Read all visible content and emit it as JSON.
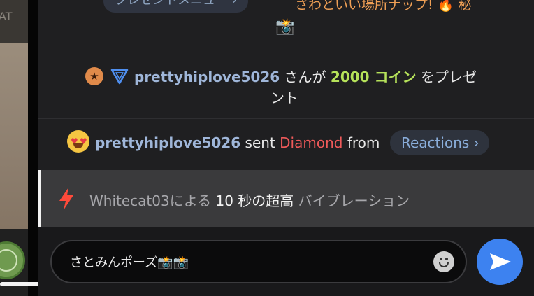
{
  "sidebar": {
    "video_text": "AT"
  },
  "chat": {
    "messages": [
      {
        "menu_chip_label": "プレゼントメニュー ›",
        "text": "さわといい場所ナップ! 🔥 秘",
        "trailing_emoji": "📸"
      },
      {
        "badges": [
          "star-badge-icon",
          "triangle-badge-icon"
        ],
        "username": "prettyhiplove5026",
        "text_before": " さんが ",
        "coins": "2000 コイン",
        "text_after": " をプレゼ",
        "text_wrap": "ント"
      },
      {
        "emoji": "heart-eyes-icon",
        "username": "prettyhiplove5026",
        "sent": " sent ",
        "gift": "Diamond",
        "from": " from ",
        "chip_label": "Reactions",
        "chip_chevron": "›"
      }
    ],
    "vibration": {
      "icon": "bolt-icon",
      "prefix": "Whitecat03による ",
      "seconds": "10",
      "seconds_unit": " 秒の",
      "level": "超高",
      "suffix": " バイブレーション"
    },
    "input": {
      "value": "さとみんポーズ📸📸",
      "emoji_button": "smiley-icon",
      "send_button": "send-icon"
    }
  },
  "colors": {
    "background": "#1f1f21",
    "username": "#9fb6d9",
    "coins": "#b6e25a",
    "gift": "#ef5a5a",
    "accent_orange": "#f0a055",
    "send_button": "#3d82f0",
    "bolt": "#ff4a3a"
  }
}
